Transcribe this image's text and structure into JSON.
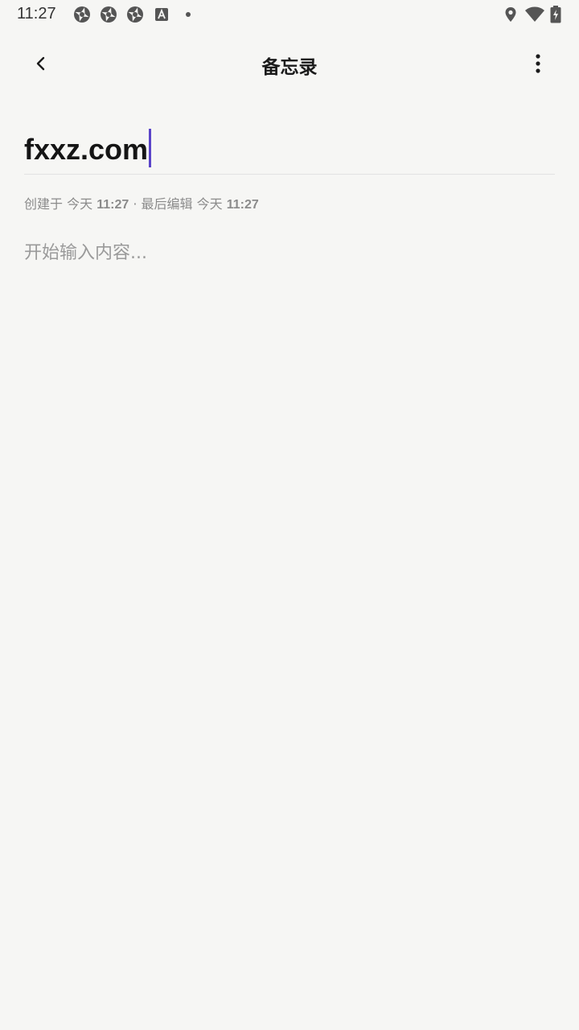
{
  "status_bar": {
    "time": "11:27",
    "icons": [
      "app-notification-icon",
      "app-notification-icon",
      "app-notification-icon",
      "font-a-icon",
      "dot-icon",
      "location-icon",
      "wifi-icon",
      "battery-charging-icon"
    ]
  },
  "app_bar": {
    "title": "备忘录",
    "back_icon": "chevron-left-icon",
    "more_icon": "more-vert-icon"
  },
  "note": {
    "title_value": "fxxz.com",
    "meta_created_label": "创建于",
    "meta_created_day": "今天",
    "meta_created_time": "11:27",
    "meta_separator": "·",
    "meta_edited_label": "最后编辑",
    "meta_edited_day": "今天",
    "meta_edited_time": "11:27",
    "content_placeholder": "开始输入内容..."
  },
  "colors": {
    "background": "#f6f6f4",
    "caret": "#5b45c9",
    "meta_text": "#8b8b8b",
    "placeholder_text": "#9a9a9a"
  }
}
